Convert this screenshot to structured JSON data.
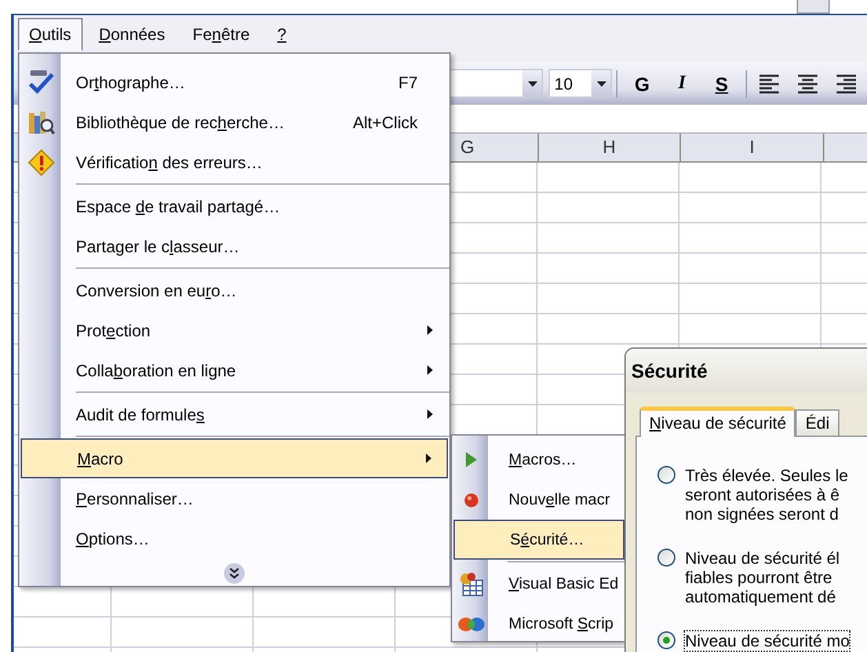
{
  "app_window": {
    "menu_bar": [
      {
        "label": [
          {
            "text": "O",
            "underline": true
          },
          {
            "text": "utils"
          }
        ],
        "selected": true
      },
      {
        "label": [
          {
            "text": "D",
            "underline": true
          },
          {
            "text": "onnées"
          }
        ],
        "selected": false
      },
      {
        "label": [
          {
            "text": "Fe"
          },
          {
            "text": "n",
            "underline": true
          },
          {
            "text": "être"
          }
        ],
        "selected": false
      },
      {
        "label": [
          {
            "text": "?",
            "underline": true
          }
        ],
        "selected": false
      }
    ],
    "toolbar": {
      "font_size": "10",
      "format_buttons": [
        {
          "kind": "bold",
          "text": "G"
        },
        {
          "kind": "italic",
          "text": "I"
        },
        {
          "kind": "underline",
          "text": "S"
        }
      ]
    },
    "column_headers": [
      "G",
      "H",
      "I"
    ]
  },
  "tools_menu": {
    "items": [
      {
        "label": [
          {
            "text": "Or"
          },
          {
            "text": "t",
            "underline": true
          },
          {
            "text": "hographe…"
          }
        ],
        "shortcut": "F7",
        "selected": false
      },
      {
        "label": [
          {
            "text": "Bibliothèque de rec"
          },
          {
            "text": "h",
            "underline": true
          },
          {
            "text": "erche…"
          }
        ],
        "shortcut": "Alt+Click",
        "selected": false
      },
      {
        "label": [
          {
            "text": "Vérificatio"
          },
          {
            "text": "n",
            "underline": true
          },
          {
            "text": " des erreurs…"
          }
        ],
        "selected": false
      },
      {
        "label": [
          {
            "text": "Espace "
          },
          {
            "text": "d",
            "underline": true
          },
          {
            "text": "e travail partagé…"
          }
        ],
        "separator_before": true,
        "selected": false
      },
      {
        "label": [
          {
            "text": "Partager le c"
          },
          {
            "text": "l",
            "underline": true
          },
          {
            "text": "asseur…"
          }
        ],
        "selected": false
      },
      {
        "label": [
          {
            "text": "Conversion en eu"
          },
          {
            "text": "r",
            "underline": true
          },
          {
            "text": "o…"
          }
        ],
        "separator_before": true,
        "selected": false
      },
      {
        "label": [
          {
            "text": "Prot"
          },
          {
            "text": "e",
            "underline": true
          },
          {
            "text": "ction"
          }
        ],
        "submenu": true,
        "selected": false
      },
      {
        "label": [
          {
            "text": "Colla"
          },
          {
            "text": "b",
            "underline": true
          },
          {
            "text": "oration en ligne"
          }
        ],
        "submenu": true,
        "selected": false
      },
      {
        "label": [
          {
            "text": "Audit de formule"
          },
          {
            "text": "s",
            "underline": true
          }
        ],
        "submenu": true,
        "separator_before": true,
        "selected": false
      },
      {
        "label": [
          {
            "text": "M",
            "underline": true
          },
          {
            "text": "acro"
          }
        ],
        "submenu": true,
        "separator_before": true,
        "selected": true
      },
      {
        "label": [
          {
            "text": "P",
            "underline": true
          },
          {
            "text": "ersonnaliser…"
          }
        ],
        "selected": false
      },
      {
        "label": [
          {
            "text": "O",
            "underline": true
          },
          {
            "text": "ptions…"
          }
        ],
        "selected": false
      }
    ]
  },
  "macro_submenu": {
    "items": [
      {
        "label": [
          {
            "text": "M",
            "underline": true
          },
          {
            "text": "acros…"
          }
        ],
        "selected": false
      },
      {
        "label": [
          {
            "text": "Nouv"
          },
          {
            "text": "e",
            "underline": true
          },
          {
            "text": "lle macr"
          }
        ],
        "selected": false
      },
      {
        "label": [
          {
            "text": "S"
          },
          {
            "text": "é",
            "underline": true
          },
          {
            "text": "curité…"
          }
        ],
        "selected": true
      },
      {
        "label": [
          {
            "text": "V",
            "underline": true
          },
          {
            "text": "isual Basic Ed"
          }
        ],
        "separator_before": true,
        "selected": false
      },
      {
        "label": [
          {
            "text": "Microsoft "
          },
          {
            "text": "S",
            "underline": true
          },
          {
            "text": "crip"
          }
        ],
        "selected": false
      }
    ]
  },
  "security_dialog": {
    "title": "Sécurité",
    "tabs": [
      {
        "label": [
          {
            "text": "N",
            "underline": true
          },
          {
            "text": "iveau de sécurité"
          }
        ],
        "selected": true
      },
      {
        "label": [
          {
            "text": "Édi"
          }
        ],
        "selected": false
      }
    ],
    "options": [
      {
        "lines": [
          "Très élevée. Seules le",
          "seront autorisées à ê",
          "non signées seront d"
        ],
        "selected": false
      },
      {
        "lines": [
          "Niveau de sécurité él",
          "fiables pourront être",
          "automatiquement dé"
        ],
        "selected": false
      },
      {
        "lines": [
          "Niveau de sécurité mo"
        ],
        "selected": true
      }
    ]
  }
}
